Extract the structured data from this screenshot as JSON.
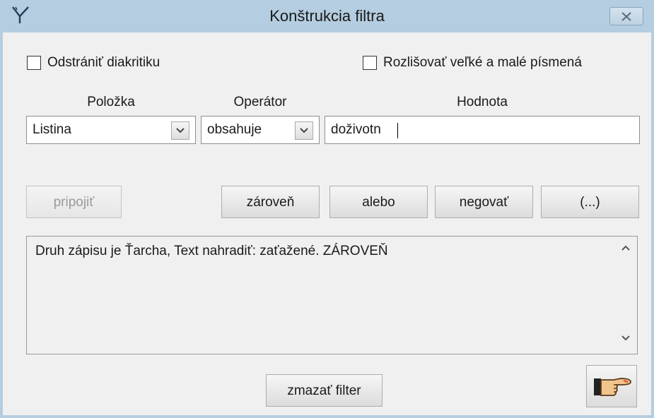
{
  "window": {
    "title": "Konštrukcia filtra",
    "icons": {
      "app": "filter-funnel-icon",
      "close": "close-icon"
    }
  },
  "options": {
    "remove_diacritics": {
      "label": "Odstrániť diakritiku",
      "checked": false
    },
    "case_sensitive": {
      "label": "Rozlišovať veľké a malé písmená",
      "checked": false
    }
  },
  "columns": {
    "item": "Položka",
    "operator": "Operátor",
    "value": "Hodnota"
  },
  "fields": {
    "item_selected": "Listina",
    "operator_selected": "obsahuje",
    "value_text": "doživotn"
  },
  "buttons": {
    "attach": "pripojiť",
    "and": "zároveň",
    "or": "alebo",
    "negate": "negovať",
    "parens": "(...)",
    "clear": "zmazať filter",
    "apply_icon": "pointing-hand-icon"
  },
  "expression": {
    "text": "Druh zápisu je Ťarcha,  Text nahradiť: zaťažené. ZÁROVEŇ"
  }
}
